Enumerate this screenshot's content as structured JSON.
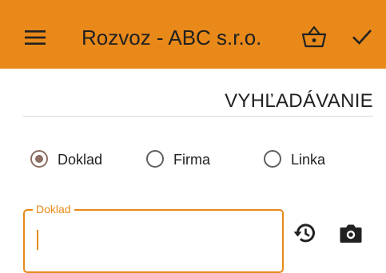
{
  "app_bar": {
    "title": "Rozvoz - ABC s.r.o.",
    "background_color": "#E8891A",
    "icons": {
      "menu": "menu-icon",
      "basket": "basket-icon",
      "confirm": "check-icon"
    }
  },
  "section": {
    "title": "VYHĽADÁVANIE"
  },
  "search_type": {
    "options": [
      {
        "label": "Doklad",
        "selected": true
      },
      {
        "label": "Firma",
        "selected": false
      },
      {
        "label": "Linka",
        "selected": false
      }
    ]
  },
  "input": {
    "label": "Doklad",
    "value": "",
    "accent_color": "#E8891A"
  },
  "actions": {
    "history_icon": "history-icon",
    "camera_icon": "camera-icon"
  }
}
